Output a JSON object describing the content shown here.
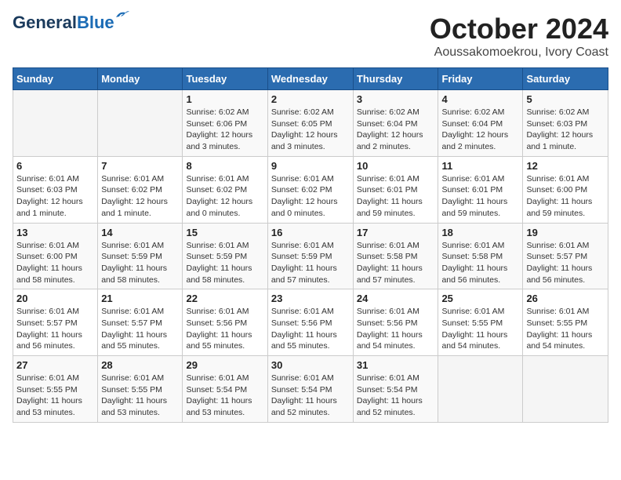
{
  "header": {
    "logo_general": "General",
    "logo_blue": "Blue",
    "month_title": "October 2024",
    "location": "Aoussakomoekrou, Ivory Coast"
  },
  "calendar": {
    "days_of_week": [
      "Sunday",
      "Monday",
      "Tuesday",
      "Wednesday",
      "Thursday",
      "Friday",
      "Saturday"
    ],
    "weeks": [
      [
        {
          "day": "",
          "info": ""
        },
        {
          "day": "",
          "info": ""
        },
        {
          "day": "1",
          "info": "Sunrise: 6:02 AM\nSunset: 6:06 PM\nDaylight: 12 hours and 3 minutes."
        },
        {
          "day": "2",
          "info": "Sunrise: 6:02 AM\nSunset: 6:05 PM\nDaylight: 12 hours and 3 minutes."
        },
        {
          "day": "3",
          "info": "Sunrise: 6:02 AM\nSunset: 6:04 PM\nDaylight: 12 hours and 2 minutes."
        },
        {
          "day": "4",
          "info": "Sunrise: 6:02 AM\nSunset: 6:04 PM\nDaylight: 12 hours and 2 minutes."
        },
        {
          "day": "5",
          "info": "Sunrise: 6:02 AM\nSunset: 6:03 PM\nDaylight: 12 hours and 1 minute."
        }
      ],
      [
        {
          "day": "6",
          "info": "Sunrise: 6:01 AM\nSunset: 6:03 PM\nDaylight: 12 hours and 1 minute."
        },
        {
          "day": "7",
          "info": "Sunrise: 6:01 AM\nSunset: 6:02 PM\nDaylight: 12 hours and 1 minute."
        },
        {
          "day": "8",
          "info": "Sunrise: 6:01 AM\nSunset: 6:02 PM\nDaylight: 12 hours and 0 minutes."
        },
        {
          "day": "9",
          "info": "Sunrise: 6:01 AM\nSunset: 6:02 PM\nDaylight: 12 hours and 0 minutes."
        },
        {
          "day": "10",
          "info": "Sunrise: 6:01 AM\nSunset: 6:01 PM\nDaylight: 11 hours and 59 minutes."
        },
        {
          "day": "11",
          "info": "Sunrise: 6:01 AM\nSunset: 6:01 PM\nDaylight: 11 hours and 59 minutes."
        },
        {
          "day": "12",
          "info": "Sunrise: 6:01 AM\nSunset: 6:00 PM\nDaylight: 11 hours and 59 minutes."
        }
      ],
      [
        {
          "day": "13",
          "info": "Sunrise: 6:01 AM\nSunset: 6:00 PM\nDaylight: 11 hours and 58 minutes."
        },
        {
          "day": "14",
          "info": "Sunrise: 6:01 AM\nSunset: 5:59 PM\nDaylight: 11 hours and 58 minutes."
        },
        {
          "day": "15",
          "info": "Sunrise: 6:01 AM\nSunset: 5:59 PM\nDaylight: 11 hours and 58 minutes."
        },
        {
          "day": "16",
          "info": "Sunrise: 6:01 AM\nSunset: 5:59 PM\nDaylight: 11 hours and 57 minutes."
        },
        {
          "day": "17",
          "info": "Sunrise: 6:01 AM\nSunset: 5:58 PM\nDaylight: 11 hours and 57 minutes."
        },
        {
          "day": "18",
          "info": "Sunrise: 6:01 AM\nSunset: 5:58 PM\nDaylight: 11 hours and 56 minutes."
        },
        {
          "day": "19",
          "info": "Sunrise: 6:01 AM\nSunset: 5:57 PM\nDaylight: 11 hours and 56 minutes."
        }
      ],
      [
        {
          "day": "20",
          "info": "Sunrise: 6:01 AM\nSunset: 5:57 PM\nDaylight: 11 hours and 56 minutes."
        },
        {
          "day": "21",
          "info": "Sunrise: 6:01 AM\nSunset: 5:57 PM\nDaylight: 11 hours and 55 minutes."
        },
        {
          "day": "22",
          "info": "Sunrise: 6:01 AM\nSunset: 5:56 PM\nDaylight: 11 hours and 55 minutes."
        },
        {
          "day": "23",
          "info": "Sunrise: 6:01 AM\nSunset: 5:56 PM\nDaylight: 11 hours and 55 minutes."
        },
        {
          "day": "24",
          "info": "Sunrise: 6:01 AM\nSunset: 5:56 PM\nDaylight: 11 hours and 54 minutes."
        },
        {
          "day": "25",
          "info": "Sunrise: 6:01 AM\nSunset: 5:55 PM\nDaylight: 11 hours and 54 minutes."
        },
        {
          "day": "26",
          "info": "Sunrise: 6:01 AM\nSunset: 5:55 PM\nDaylight: 11 hours and 54 minutes."
        }
      ],
      [
        {
          "day": "27",
          "info": "Sunrise: 6:01 AM\nSunset: 5:55 PM\nDaylight: 11 hours and 53 minutes."
        },
        {
          "day": "28",
          "info": "Sunrise: 6:01 AM\nSunset: 5:55 PM\nDaylight: 11 hours and 53 minutes."
        },
        {
          "day": "29",
          "info": "Sunrise: 6:01 AM\nSunset: 5:54 PM\nDaylight: 11 hours and 53 minutes."
        },
        {
          "day": "30",
          "info": "Sunrise: 6:01 AM\nSunset: 5:54 PM\nDaylight: 11 hours and 52 minutes."
        },
        {
          "day": "31",
          "info": "Sunrise: 6:01 AM\nSunset: 5:54 PM\nDaylight: 11 hours and 52 minutes."
        },
        {
          "day": "",
          "info": ""
        },
        {
          "day": "",
          "info": ""
        }
      ]
    ]
  }
}
